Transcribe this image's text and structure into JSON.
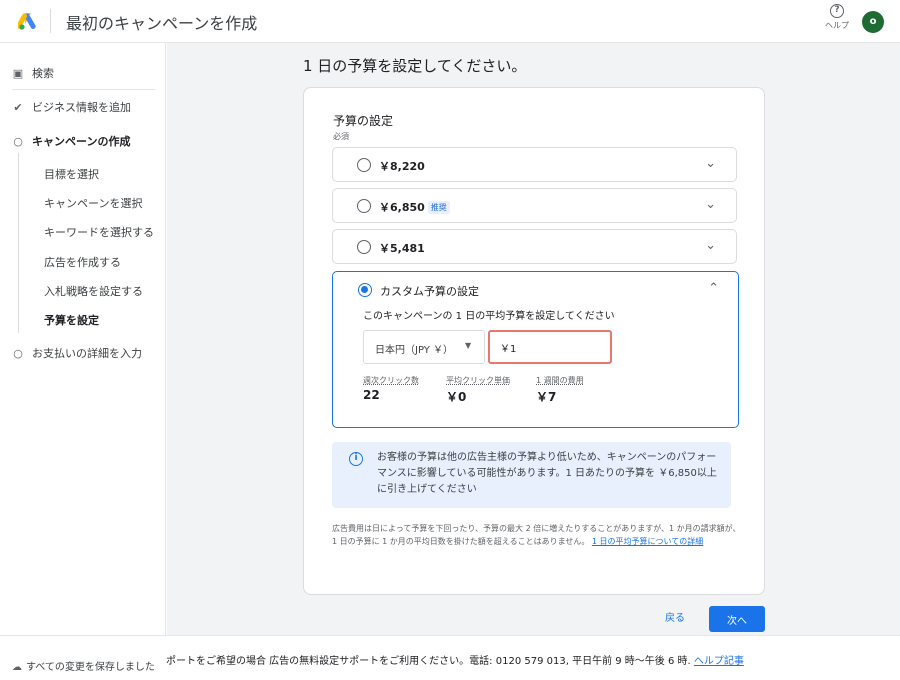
{
  "header": {
    "title": "最初のキャンペーンを作成",
    "help_label": "ヘルプ",
    "avatar_initial": "o",
    "accent": "#1a73e8"
  },
  "sidebar": {
    "search": "検索",
    "add_business": "ビジネス情報を追加",
    "campaign_create": "キャンペーンの作成",
    "steps": [
      "目標を選択",
      "キャンペーンを選択",
      "キーワードを選択する",
      "広告を作成する",
      "入札戦略を設定する",
      "予算を設定"
    ],
    "payment": "お支払いの詳細を入力"
  },
  "main": {
    "page_title": "1 日の予算を設定してください。",
    "section_title": "予算の設定",
    "required": "必須",
    "options": [
      {
        "amount": "￥8,220",
        "badge": ""
      },
      {
        "amount": "￥6,850",
        "badge": "推奨"
      },
      {
        "amount": "￥5,481",
        "badge": ""
      }
    ],
    "custom": {
      "label": "カスタム予算の設定",
      "description": "このキャンペーンの 1 日の平均予算を設定してください",
      "currency": "日本円（JPY ￥）",
      "amount_value": "￥1",
      "stats": [
        {
          "label": "週次クリック数",
          "value": "22"
        },
        {
          "label": "平均クリック単価",
          "value": "￥0"
        },
        {
          "label": "1 週間の費用",
          "value": "￥7"
        }
      ]
    },
    "alert": "お客様の予算は他の広告主様の予算より低いため、キャンペーンのパフォーマンスに影響している可能性があります。1 日あたりの予算を ￥6,850以上に引き上げてください",
    "fine_print": "広告費用は日によって予算を下回ったり、予算の最大 2 倍に増えたりすることがありますが、1 か月の請求額が、1 日の予算に 1 か月の平均日数を掛けた額を超えることはありません。",
    "fine_link": "1 日の平均予算についての詳細",
    "back": "戻る",
    "next": "次へ"
  },
  "footer": {
    "save_status": "すべての変更を保存しました",
    "support_text": "ポートをご希望の場合 広告の無料設定サポートをご利用ください。電話: 0120 579 013, 平日午前 9 時〜午後 6 時.",
    "support_link": "ヘルプ記事"
  }
}
